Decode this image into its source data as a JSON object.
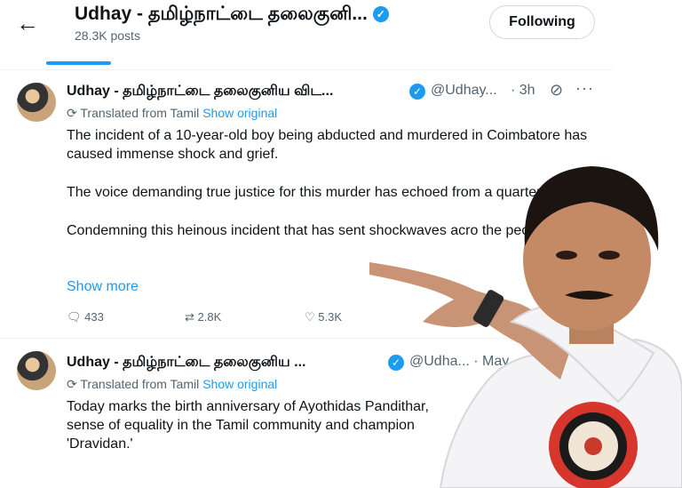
{
  "header": {
    "back_icon": "arrow-left-icon",
    "title": "Udhay - தமிழ்நாட்டை தலைகுனி...",
    "posts_count": "28.3K posts",
    "following_label": "Following"
  },
  "tweets": [
    {
      "name": "Udhay - தமிழ்நாட்டை தலைகுனிய விட...",
      "handle": "@Udhay...",
      "time": "· 3h",
      "translated_label": "Translated from Tamil",
      "show_original": "Show original",
      "paragraphs": [
        "The incident of a 10-year-old boy being abducted and murdered in Coimbatore has caused immense shock and grief.",
        "The voice demanding true justice for this murder has echoed from a quarters.",
        "Condemning this heinous incident that has sent shockwaves acro the people of"
      ],
      "show_more": "Show more",
      "replies": "433",
      "reposts": "2.8K",
      "likes": "5.3K"
    },
    {
      "name": "Udhay - தமிழ்நாட்டை தலைகுனிய ...",
      "handle": "@Udha... · May",
      "translated_label": "Translated from Tamil",
      "show_original": "Show original",
      "paragraphs": [
        "Today marks the birth anniversary of Ayothidas Pandithar, sense of equality in the Tamil community and champion 'Dravidan.'"
      ]
    }
  ],
  "colors": {
    "accent": "#1d9bf0",
    "muted": "#536471",
    "text": "#0f1419"
  }
}
